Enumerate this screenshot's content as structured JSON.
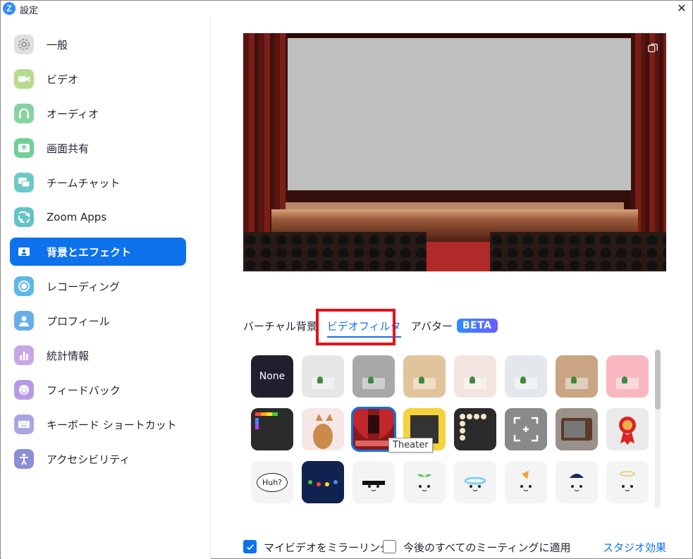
{
  "window": {
    "app_icon": "Z",
    "title": "設定",
    "close_symbol": "✕"
  },
  "sidebar": {
    "active_index": 6,
    "items": [
      {
        "label": "一般",
        "icon": "gear-icon",
        "color": "#e0e0e0"
      },
      {
        "label": "ビデオ",
        "icon": "video-camera-icon",
        "color": "#b6dc8f"
      },
      {
        "label": "オーディオ",
        "icon": "headphones-icon",
        "color": "#86d3a0"
      },
      {
        "label": "画面共有",
        "icon": "share-screen-icon",
        "color": "#6fcf97"
      },
      {
        "label": "チームチャット",
        "icon": "chat-bubbles-icon",
        "color": "#6cc7c7"
      },
      {
        "label": "Zoom Apps",
        "icon": "apps-icon",
        "color": "#63c3c7"
      },
      {
        "label": "背景とエフェクト",
        "icon": "background-portrait-icon",
        "color": "#0e72ed"
      },
      {
        "label": "レコーディング",
        "icon": "record-icon",
        "color": "#5cb8e6"
      },
      {
        "label": "プロフィール",
        "icon": "profile-icon",
        "color": "#66aee8"
      },
      {
        "label": "統計情報",
        "icon": "bar-chart-icon",
        "color": "#c7a6e8"
      },
      {
        "label": "フィードバック",
        "icon": "smile-icon",
        "color": "#b79be8"
      },
      {
        "label": "キーボード ショートカット",
        "icon": "keyboard-icon",
        "color": "#a8a6e3"
      },
      {
        "label": "アクセシビリティ",
        "icon": "accessibility-icon",
        "color": "#8c8fd6"
      }
    ]
  },
  "preview": {
    "description_icon": "copy-window-icon"
  },
  "tabs": {
    "virtual_background": "バーチャル背景",
    "video_filter": "ビデオフィルタ",
    "avatar": "アバター",
    "beta_badge": "BETA"
  },
  "filters": {
    "tooltip": "Theater",
    "selected_index": 10,
    "tiles": [
      {
        "name": "none",
        "label": "None",
        "bg": "#1f1f2e"
      },
      {
        "name": "light-gray-room",
        "bg": "#e6e6e6"
      },
      {
        "name": "gray-room",
        "bg": "#a8a8a8"
      },
      {
        "name": "beige-room",
        "bg": "#e2c49c"
      },
      {
        "name": "pink-room",
        "bg": "#f2e4df"
      },
      {
        "name": "pale-blue-room",
        "bg": "#e4e8ec"
      },
      {
        "name": "tan-room",
        "bg": "#c9a583"
      },
      {
        "name": "pink-gradient-room",
        "bg": "#f9b8bf"
      },
      {
        "name": "color-bar-frame",
        "bg": "#2b2b2b"
      },
      {
        "name": "dog-frame",
        "bg": "#f6e6e6"
      },
      {
        "name": "theater",
        "bg": "#8a1a1a"
      },
      {
        "name": "emoji-frame",
        "bg": "#f7d23a"
      },
      {
        "name": "bulb-frame",
        "bg": "#2b2b2b"
      },
      {
        "name": "focus-frame",
        "bg": "#8a8a8a"
      },
      {
        "name": "tv-frame",
        "bg": "#7a6e66"
      },
      {
        "name": "medal",
        "bg": "#eaeaea"
      },
      {
        "name": "huh-bubble",
        "label": "Huh?",
        "bg": "#f4f4f4"
      },
      {
        "name": "string-lights",
        "bg": "#102350"
      },
      {
        "name": "pixel-sunglasses",
        "bg": "#f4f4f4"
      },
      {
        "name": "sprout",
        "bg": "#f4f4f4"
      },
      {
        "name": "rainbow-halo",
        "bg": "#f4f4f4"
      },
      {
        "name": "pizza",
        "bg": "#f4f4f4"
      },
      {
        "name": "zoom-cap",
        "bg": "#f4f4f4"
      },
      {
        "name": "halo",
        "bg": "#f4f4f4"
      }
    ]
  },
  "bottom": {
    "mirror_label": "マイビデオをミラーリング",
    "mirror_checked": true,
    "apply_all_label": "今後のすべてのミーティングに適用",
    "apply_all_checked": false,
    "studio_effects_link": "スタジオ効果"
  }
}
